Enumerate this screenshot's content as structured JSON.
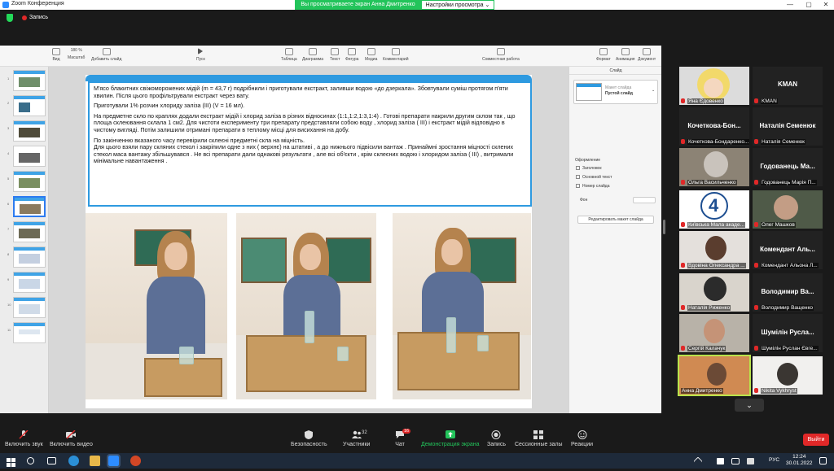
{
  "window": {
    "title": "Zoom Конференция",
    "controls": [
      "—",
      "▢",
      "✕"
    ]
  },
  "topbar": {
    "recording": "Запись",
    "share_banner": "Вы просматриваете экран Анна Дмитренко",
    "view_options": "Настройки просмотра ⌄"
  },
  "keynote": {
    "toolbar": {
      "view": "Вид",
      "zoom_value": "180 %",
      "zoom": "Масштаб",
      "add_slide": "Добавить слайд",
      "play": "Пуск",
      "table": "Таблица",
      "chart": "Диаграмма",
      "text": "Текст",
      "shape": "Фигура",
      "media": "Медиа",
      "comment": "Комментарий",
      "collab": "Совместная работа",
      "format": "Формат",
      "animation": "Анимация",
      "document": "Документ"
    },
    "slide_numbers": [
      "1",
      "2",
      "3",
      "4",
      "5",
      "6",
      "7",
      "8",
      "9",
      "10",
      "11"
    ],
    "slide_text": {
      "p1": "М'ясо блакитних свіжоморожених мідій (m = 43,7 г) подрібнили і приготували екстракт, заливши водою «до дзеркала». Збовтували суміш протягом п'яти хвилин. Після цього профільтрували екстракт через вату.",
      "p2": "Приготували 1% розчин хлориду заліза (III) (V = 16 мл).",
      "p3": "На предметне скло по краплях додали екстракт мідій і хлорид заліза в різних відносинах (1:1,1:2,1:3,1:4) . Готові препарати накрили другим склом так , що площа склеювання склала 1 см2. Для чистоти експерименту три препарату представляли собою воду , хлорид заліза ( III) і екстракт мідій відповідно в чистому вигляді. Потім залишили отримані препарати в теплому місці для висихання на добу.",
      "p4": "По закінченню вказаного часу перевірили склеєні предметні скла на міцність.",
      "p5": "Для цього взяли пару скляних стекол і закріпили одне з них ( верхнє) на штативі , а до нижнього підвісили вантаж . Принаймні зростання міцності склених стекол маса вантажу збільшувався . Не всі препарати дали однакові результати , але всі об'єкти , крім склеєних водою і хлоридом заліза ( III) , витримали мінімальне навантаження ."
    },
    "format_panel": {
      "tab": "Слайд",
      "layout_label": "Макет слайда",
      "layout_value": "Пустой слайд",
      "appearance": "Оформление",
      "checks": [
        "Заголовок",
        "Основной текст",
        "Номер слайда"
      ],
      "background": "Фон",
      "edit_layout": "Редактировать макет слайда"
    }
  },
  "participants": [
    {
      "name": "Яна Єдовенко",
      "big": ""
    },
    {
      "name": "KMAN",
      "big": "KMAN"
    },
    {
      "name": "Кочеткова-Бондаренко...",
      "big": "Кочеткова-Бон..."
    },
    {
      "name": "Наталія Семенюк",
      "big": "Наталія Семенюк"
    },
    {
      "name": "Ольга Васильченко",
      "big": ""
    },
    {
      "name": "Годованець Марія П...",
      "big": "Годованець Ма..."
    },
    {
      "name": "Київська Мала акаде...",
      "big": ""
    },
    {
      "name": "Олег Машков",
      "big": ""
    },
    {
      "name": "Вдовіна Олександра ...",
      "big": ""
    },
    {
      "name": "Комендант Альона Л...",
      "big": "Комендант Аль..."
    },
    {
      "name": "Наталія Риженко",
      "big": ""
    },
    {
      "name": "Володимир Ващенко",
      "big": "Володимир Ва..."
    },
    {
      "name": "Сергій Калачук",
      "big": ""
    },
    {
      "name": "Шумілін Руслан Євге...",
      "big": "Шумілін Русла..."
    },
    {
      "name": "Анна Дмитренко",
      "big": ""
    },
    {
      "name": "Nikita Vykhryst",
      "big": ""
    }
  ],
  "controls": {
    "mute": "Включить звук",
    "video": "Включить видео",
    "security": "Безопасность",
    "participants": "Участники",
    "participants_count": "32",
    "chat": "Чат",
    "chat_badge": "16",
    "share": "Демонстрация экрана",
    "record": "Запись",
    "breakout": "Сессионные залы",
    "reactions": "Реакции",
    "leave": "Выйти"
  },
  "taskbar": {
    "lang": "РУС",
    "time": "12:24",
    "date": "30.01.2022"
  },
  "colors": {
    "accent_green": "#23c45b",
    "slide_blue": "#2e9ae0",
    "leave_red": "#e02828"
  }
}
